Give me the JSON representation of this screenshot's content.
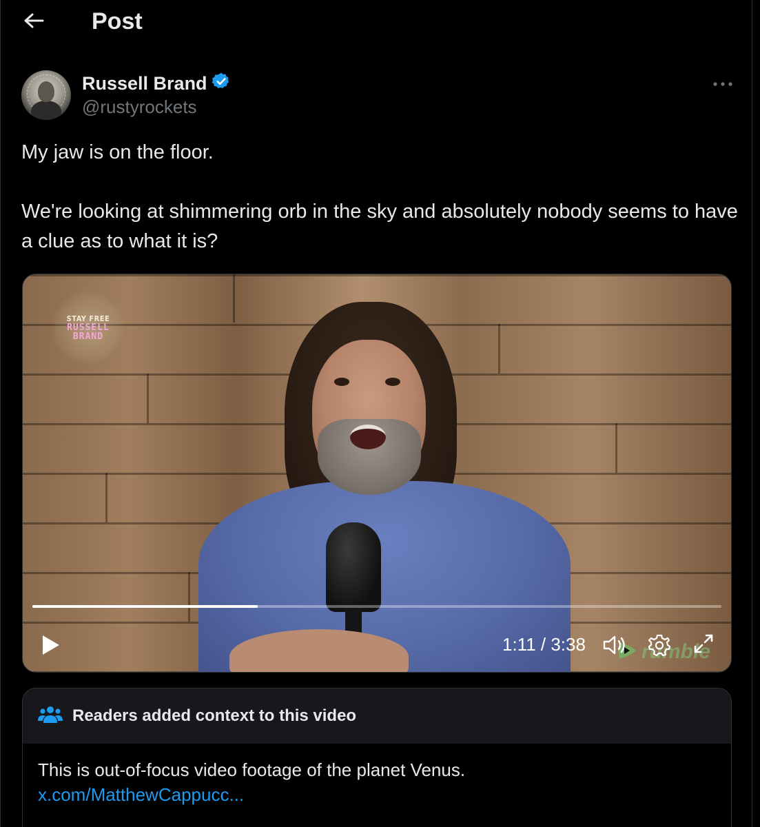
{
  "header": {
    "title": "Post",
    "back_icon": "arrow-left-icon"
  },
  "post": {
    "author": {
      "name": "Russell Brand",
      "handle": "@rustyrockets",
      "verified": true,
      "verified_color": "#1d9bf0"
    },
    "text_lines": [
      "My jaw is on the floor.",
      "We're looking at shimmering orb in the sky and absolutely nobody seems to have a clue as to what it is?"
    ]
  },
  "video": {
    "overlay_logo": {
      "line1": "STAY FREE",
      "line2": "RUSSELL",
      "line3": "BRAND"
    },
    "time_display": "1:11 / 3:38",
    "progress_fraction": 0.327,
    "watermark": "rumble"
  },
  "context_note": {
    "title": "Readers added context to this video",
    "text": "This is out-of-focus video footage of the planet Venus.",
    "link": "x.com/MatthewCappucc..."
  },
  "colors": {
    "background": "#000000",
    "text_primary": "#e7e9ea",
    "text_secondary": "#71767b",
    "accent": "#1d9bf0",
    "note_header": "#16181c"
  }
}
